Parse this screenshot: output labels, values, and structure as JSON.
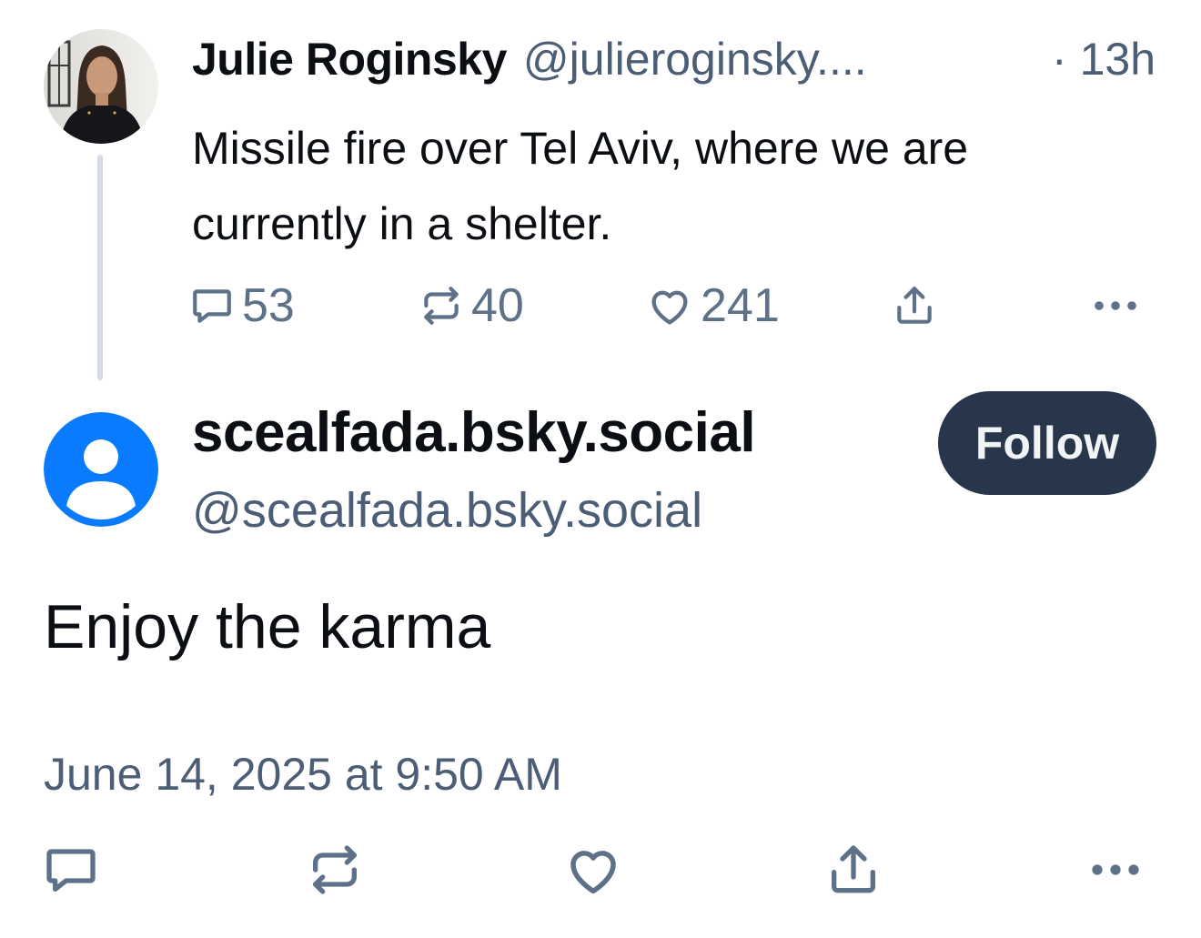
{
  "parent_post": {
    "author_name": "Julie Roginsky",
    "author_handle": "@julieroginsky....",
    "time": "· 13h",
    "text": "Missile fire over Tel Aviv, where we are currently in a shelter.",
    "counts": {
      "replies": "53",
      "reposts": "40",
      "likes": "241"
    }
  },
  "reply_post": {
    "author_name": "scealfada.bsky.social",
    "author_handle": "@scealfada.bsky.social",
    "follow_label": "Follow",
    "text": "Enjoy the karma",
    "timestamp": "June 14, 2025 at 9:50 AM"
  },
  "colors": {
    "text_primary": "#0b0f14",
    "text_secondary": "#4b5e75",
    "icon_gray": "#5d7189",
    "follow_button_bg": "#27364a",
    "default_avatar_blue": "#0a7aff",
    "thread_line": "#d4dbe2"
  },
  "icons": [
    "reply-icon",
    "repost-icon",
    "like-icon",
    "share-icon",
    "more-icon",
    "default-avatar-icon"
  ]
}
